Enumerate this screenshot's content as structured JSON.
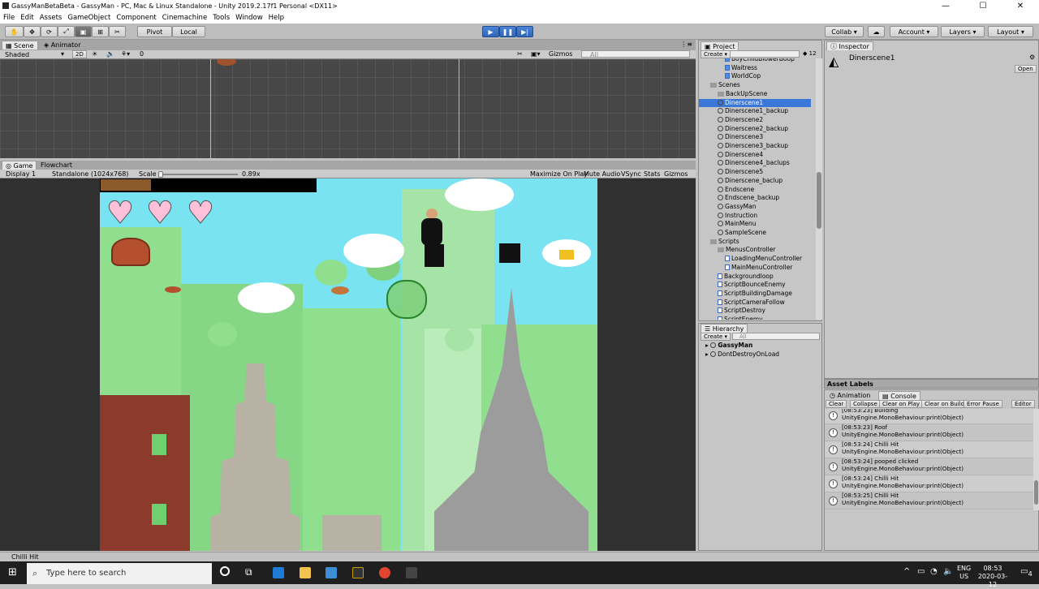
{
  "title": "GassyManBetaBeta - GassyMan - PC, Mac & Linux Standalone - Unity 2019.2.17f1 Personal <DX11>",
  "window_controls": [
    "—",
    "☐",
    "✕"
  ],
  "menu": [
    "File",
    "Edit",
    "Assets",
    "GameObject",
    "Component",
    "Cinemachine",
    "Tools",
    "Window",
    "Help"
  ],
  "toolbar": {
    "pivot": "Pivot",
    "local": "Local",
    "collab": "Collab ▾",
    "account": "Account",
    "layers": "Layers",
    "layout": "Layout"
  },
  "scene": {
    "tabs": [
      "Scene",
      "Animator"
    ],
    "shading": "Shaded",
    "mode_2d": "2D",
    "gizmos": "Gizmos",
    "search_placeholder": "All",
    "counter": "0"
  },
  "game": {
    "tabs": [
      "Game",
      "Flowchart"
    ],
    "display": "Display 1",
    "resolution": "Standalone (1024x768)",
    "scale_label": "Scale",
    "scale_value": "0.89x",
    "options": [
      "Maximize On Play",
      "Mute Audio",
      "VSync",
      "Stats",
      "Gizmos"
    ],
    "hearts": 3
  },
  "project": {
    "tab": "Project",
    "create": "Create",
    "count": "12",
    "items": [
      {
        "label": "BoyChildBlowerBoop",
        "type": "prefab",
        "indent": 2
      },
      {
        "label": "Waitress",
        "type": "prefab",
        "indent": 2
      },
      {
        "label": "WorldCop",
        "type": "prefab",
        "indent": 2
      },
      {
        "label": "Scenes",
        "type": "folder",
        "indent": 0
      },
      {
        "label": "BackUpScene",
        "type": "folder",
        "indent": 1
      },
      {
        "label": "Dinerscene1",
        "type": "scene",
        "indent": 1,
        "selected": true
      },
      {
        "label": "Dinerscene1_backup",
        "type": "scene",
        "indent": 1
      },
      {
        "label": "Dinerscene2",
        "type": "scene",
        "indent": 1
      },
      {
        "label": "Dinerscene2_backup",
        "type": "scene",
        "indent": 1
      },
      {
        "label": "Dinerscene3",
        "type": "scene",
        "indent": 1
      },
      {
        "label": "Dinerscene3_backup",
        "type": "scene",
        "indent": 1
      },
      {
        "label": "Dinerscene4",
        "type": "scene",
        "indent": 1
      },
      {
        "label": "Dinerscene4_baclups",
        "type": "scene",
        "indent": 1
      },
      {
        "label": "Dinerscene5",
        "type": "scene",
        "indent": 1
      },
      {
        "label": "Dinerscene_baclup",
        "type": "scene",
        "indent": 1
      },
      {
        "label": "Endscene",
        "type": "scene",
        "indent": 1
      },
      {
        "label": "Endscene_backup",
        "type": "scene",
        "indent": 1
      },
      {
        "label": "GassyMan",
        "type": "scene",
        "indent": 1
      },
      {
        "label": "Instruction",
        "type": "scene",
        "indent": 1
      },
      {
        "label": "MainMenu",
        "type": "scene",
        "indent": 1
      },
      {
        "label": "SampleScene",
        "type": "scene",
        "indent": 1
      },
      {
        "label": "Scripts",
        "type": "folder",
        "indent": 0
      },
      {
        "label": "MenusController",
        "type": "folder",
        "indent": 1
      },
      {
        "label": "LoadingMenuController",
        "type": "script",
        "indent": 2
      },
      {
        "label": "MainMenuController",
        "type": "script",
        "indent": 2
      },
      {
        "label": "Backgroundloop",
        "type": "script",
        "indent": 1
      },
      {
        "label": "ScriptBounceEnemy",
        "type": "script",
        "indent": 1
      },
      {
        "label": "ScriptBuildingDamage",
        "type": "script",
        "indent": 1
      },
      {
        "label": "ScriptCameraFollow",
        "type": "script",
        "indent": 1
      },
      {
        "label": "ScriptDestroy",
        "type": "script",
        "indent": 1
      },
      {
        "label": "ScriptEnemy",
        "type": "script",
        "indent": 1
      }
    ]
  },
  "hierarchy": {
    "tab": "Hierarchy",
    "create": "Create",
    "search_placeholder": "All",
    "items": [
      "GassyMan",
      "DontDestroyOnLoad"
    ]
  },
  "inspector": {
    "tab": "Inspector",
    "asset_name": "Dinerscene1",
    "open": "Open"
  },
  "asset_labels": "Asset Labels",
  "console": {
    "tabs": [
      "Animation",
      "Console"
    ],
    "buttons": [
      "Clear",
      "Collapse",
      "Clear on Play",
      "Clear on Build",
      "Error Pause",
      "Editor"
    ],
    "entries": [
      {
        "line1": "[08:53:23] Building",
        "line2": "UnityEngine.MonoBehaviour:print(Object)"
      },
      {
        "line1": "[08:53:23] Roof",
        "line2": "UnityEngine.MonoBehaviour:print(Object)"
      },
      {
        "line1": "[08:53:24] Chilli Hit",
        "line2": "UnityEngine.MonoBehaviour:print(Object)"
      },
      {
        "line1": "[08:53:24] pooped clicked",
        "line2": "UnityEngine.MonoBehaviour:print(Object)"
      },
      {
        "line1": "[08:53:24] Chilli Hit",
        "line2": "UnityEngine.MonoBehaviour:print(Object)"
      },
      {
        "line1": "[08:53:25] Chilli Hit",
        "line2": "UnityEngine.MonoBehaviour:print(Object)"
      }
    ]
  },
  "status": "Chilli Hit",
  "taskbar": {
    "search_placeholder": "Type here to search",
    "lang": "ENG",
    "region": "US",
    "time": "08:53",
    "date": "2020-03-12",
    "notifications": "4"
  },
  "colors": {
    "sky": "#79e3f1",
    "selection": "#3b77d8",
    "play_blue": "#3a74cc"
  }
}
